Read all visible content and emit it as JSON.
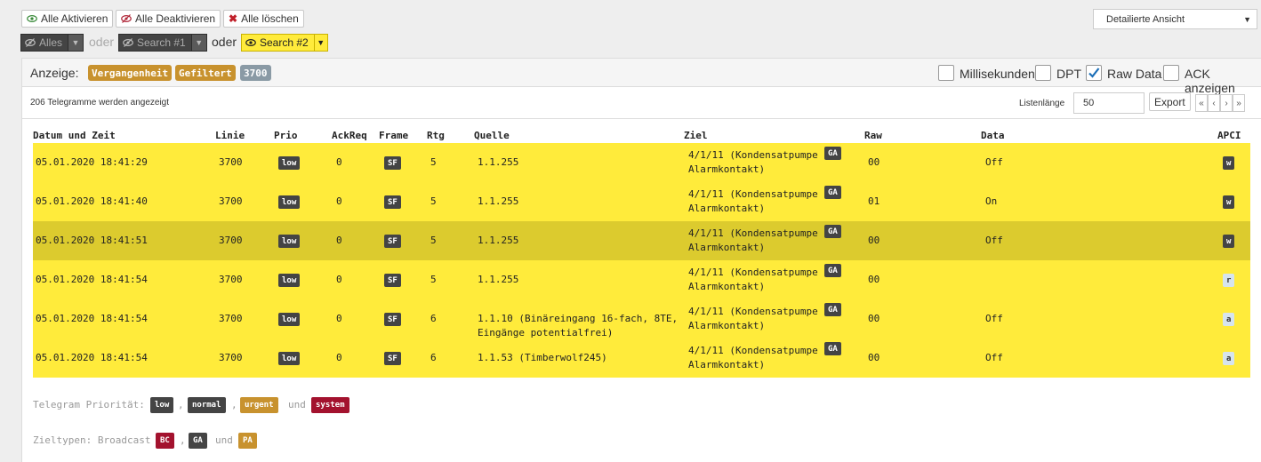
{
  "toolbar": {
    "activate_all": "Alle Aktivieren",
    "deactivate_all": "Alle Deaktivieren",
    "delete_all": "Alle löschen"
  },
  "filters": {
    "all": "Alles",
    "or1": "oder",
    "search1": "Search #1",
    "or2": "oder",
    "search2": "Search #2"
  },
  "view_select": "Detailierte Ansicht",
  "display": {
    "label": "Anzeige:",
    "past": "Vergangenheit",
    "filtered": "Gefiltert",
    "count": "3700"
  },
  "options": {
    "milliseconds": {
      "label": "Millisekunden",
      "checked": false
    },
    "dpt": {
      "label": "DPT",
      "checked": false
    },
    "raw": {
      "label": "Raw Data",
      "checked": true
    },
    "ack": {
      "label": "ACK anzeigen",
      "checked": false
    }
  },
  "status": "206 Telegramme werden angezeigt",
  "list_length": {
    "label": "Listenlänge",
    "value": "50"
  },
  "export": "Export",
  "pager": [
    "«",
    "‹",
    "›",
    "»"
  ],
  "columns": {
    "date": "Datum und Zeit",
    "line": "Linie",
    "prio": "Prio",
    "ackreq": "AckReq",
    "frame": "Frame",
    "rtg": "Rtg",
    "source": "Quelle",
    "target": "Ziel",
    "raw": "Raw",
    "data": "Data",
    "apci": "APCI"
  },
  "rows": [
    {
      "date": "05.01.2020 18:41:29",
      "line": "3700",
      "prio": "low",
      "ackreq": "0",
      "frame": "SF",
      "rtg": "5",
      "source1": "1.1.255",
      "source2": "",
      "target1": "4/1/11 (Kondensatpumpe",
      "target2": "Alarmkontakt)",
      "ga": "GA",
      "raw": "00",
      "data": "Off",
      "apci": "w"
    },
    {
      "date": "05.01.2020 18:41:40",
      "line": "3700",
      "prio": "low",
      "ackreq": "0",
      "frame": "SF",
      "rtg": "5",
      "source1": "1.1.255",
      "source2": "",
      "target1": "4/1/11 (Kondensatpumpe",
      "target2": "Alarmkontakt)",
      "ga": "GA",
      "raw": "01",
      "data": "On",
      "apci": "w"
    },
    {
      "date": "05.01.2020 18:41:51",
      "line": "3700",
      "prio": "low",
      "ackreq": "0",
      "frame": "SF",
      "rtg": "5",
      "source1": "1.1.255",
      "source2": "",
      "target1": "4/1/11 (Kondensatpumpe",
      "target2": "Alarmkontakt)",
      "ga": "GA",
      "raw": "00",
      "data": "Off",
      "apci": "w"
    },
    {
      "date": "05.01.2020 18:41:54",
      "line": "3700",
      "prio": "low",
      "ackreq": "0",
      "frame": "SF",
      "rtg": "5",
      "source1": "1.1.255",
      "source2": "",
      "target1": "4/1/11 (Kondensatpumpe",
      "target2": "Alarmkontakt)",
      "ga": "GA",
      "raw": "00",
      "data": "",
      "apci": "r"
    },
    {
      "date": "05.01.2020 18:41:54",
      "line": "3700",
      "prio": "low",
      "ackreq": "0",
      "frame": "SF",
      "rtg": "6",
      "source1": "1.1.10 (Binäreingang 16-fach, 8TE,",
      "source2": "Eingänge potentialfrei)",
      "target1": "4/1/11 (Kondensatpumpe",
      "target2": "Alarmkontakt)",
      "ga": "GA",
      "raw": "00",
      "data": "Off",
      "apci": "a"
    },
    {
      "date": "05.01.2020 18:41:54",
      "line": "3700",
      "prio": "low",
      "ackreq": "0",
      "frame": "SF",
      "rtg": "6",
      "source1": "1.1.53 (Timberwolf245)",
      "source2": "",
      "target1": "4/1/11 (Kondensatpumpe",
      "target2": "Alarmkontakt)",
      "ga": "GA",
      "raw": "00",
      "data": "Off",
      "apci": "a"
    }
  ],
  "legend_priority": {
    "label": "Telegram Priorität:",
    "low": "low",
    "sep1": ",",
    "normal": "normal",
    "sep2": ",",
    "urgent": "urgent",
    "and": "und",
    "system": "system"
  },
  "legend_target": {
    "label": "Zieltypen: Broadcast",
    "bc": "BC",
    "sep1": ",",
    "ga": "GA",
    "and": "und",
    "pa": "PA"
  },
  "colors": {
    "row": "#ffeb3b",
    "row_hover": "#dccb2e",
    "orange": "#c8922e",
    "dark": "#444444",
    "red": "#a3122e"
  }
}
